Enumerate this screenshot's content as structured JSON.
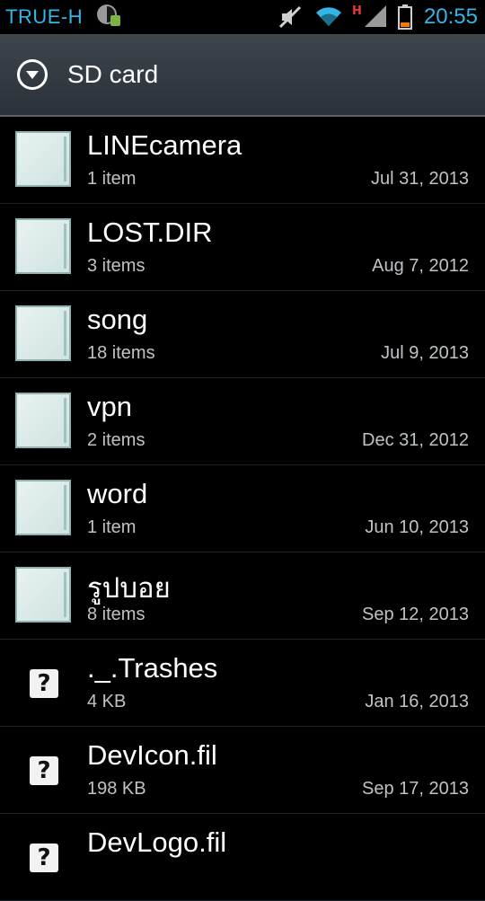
{
  "status_bar": {
    "carrier": "TRUE-H",
    "time": "20:55",
    "icons": [
      "android-debug-icon",
      "mute-icon",
      "wifi-icon",
      "signal-icon",
      "battery-icon"
    ],
    "accent_color": "#33b5e5"
  },
  "header": {
    "title": "SD card",
    "menu_icon": "chevron-down-circle-icon"
  },
  "files": [
    {
      "name": "LINEcamera",
      "meta": "1 item",
      "date": "Jul 31, 2013",
      "type": "folder"
    },
    {
      "name": "LOST.DIR",
      "meta": "3 items",
      "date": "Aug 7, 2012",
      "type": "folder"
    },
    {
      "name": "song",
      "meta": "18 items",
      "date": "Jul 9, 2013",
      "type": "folder"
    },
    {
      "name": "vpn",
      "meta": "2 items",
      "date": "Dec 31, 2012",
      "type": "folder"
    },
    {
      "name": "word",
      "meta": "1 item",
      "date": "Jun 10, 2013",
      "type": "folder"
    },
    {
      "name": "รูปบอย",
      "meta": "8 items",
      "date": "Sep 12, 2013",
      "type": "folder"
    },
    {
      "name": "._.Trashes",
      "meta": "4 KB",
      "date": "Jan 16, 2013",
      "type": "file",
      "icon_glyph": "?"
    },
    {
      "name": "DevIcon.fil",
      "meta": "198 KB",
      "date": "Sep 17, 2013",
      "type": "file",
      "icon_glyph": "?"
    },
    {
      "name": "DevLogo.fil",
      "meta": "",
      "date": "",
      "type": "file",
      "icon_glyph": "?"
    }
  ]
}
